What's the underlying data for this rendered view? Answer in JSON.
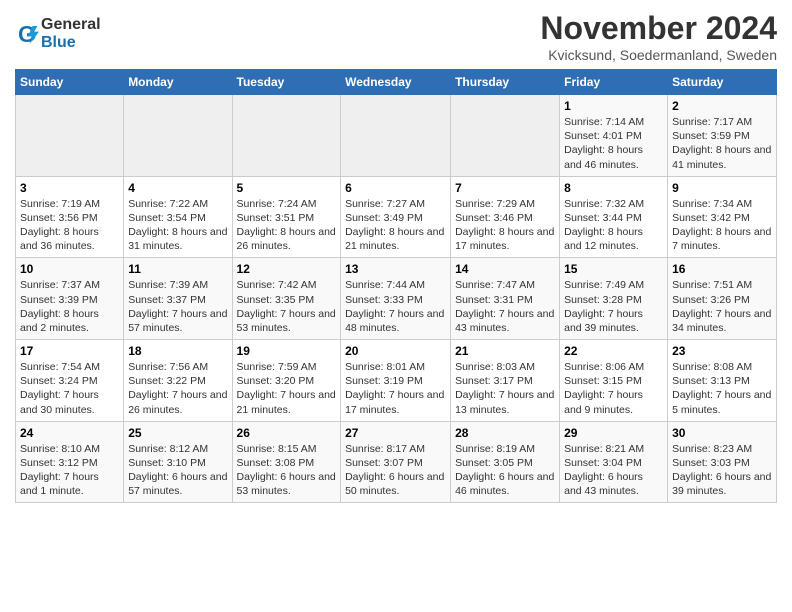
{
  "header": {
    "logo_general": "General",
    "logo_blue": "Blue",
    "title": "November 2024",
    "subtitle": "Kvicksund, Soedermanland, Sweden"
  },
  "weekdays": [
    "Sunday",
    "Monday",
    "Tuesday",
    "Wednesday",
    "Thursday",
    "Friday",
    "Saturday"
  ],
  "weeks": [
    [
      {
        "day": "",
        "info": ""
      },
      {
        "day": "",
        "info": ""
      },
      {
        "day": "",
        "info": ""
      },
      {
        "day": "",
        "info": ""
      },
      {
        "day": "",
        "info": ""
      },
      {
        "day": "1",
        "info": "Sunrise: 7:14 AM\nSunset: 4:01 PM\nDaylight: 8 hours and 46 minutes."
      },
      {
        "day": "2",
        "info": "Sunrise: 7:17 AM\nSunset: 3:59 PM\nDaylight: 8 hours and 41 minutes."
      }
    ],
    [
      {
        "day": "3",
        "info": "Sunrise: 7:19 AM\nSunset: 3:56 PM\nDaylight: 8 hours and 36 minutes."
      },
      {
        "day": "4",
        "info": "Sunrise: 7:22 AM\nSunset: 3:54 PM\nDaylight: 8 hours and 31 minutes."
      },
      {
        "day": "5",
        "info": "Sunrise: 7:24 AM\nSunset: 3:51 PM\nDaylight: 8 hours and 26 minutes."
      },
      {
        "day": "6",
        "info": "Sunrise: 7:27 AM\nSunset: 3:49 PM\nDaylight: 8 hours and 21 minutes."
      },
      {
        "day": "7",
        "info": "Sunrise: 7:29 AM\nSunset: 3:46 PM\nDaylight: 8 hours and 17 minutes."
      },
      {
        "day": "8",
        "info": "Sunrise: 7:32 AM\nSunset: 3:44 PM\nDaylight: 8 hours and 12 minutes."
      },
      {
        "day": "9",
        "info": "Sunrise: 7:34 AM\nSunset: 3:42 PM\nDaylight: 8 hours and 7 minutes."
      }
    ],
    [
      {
        "day": "10",
        "info": "Sunrise: 7:37 AM\nSunset: 3:39 PM\nDaylight: 8 hours and 2 minutes."
      },
      {
        "day": "11",
        "info": "Sunrise: 7:39 AM\nSunset: 3:37 PM\nDaylight: 7 hours and 57 minutes."
      },
      {
        "day": "12",
        "info": "Sunrise: 7:42 AM\nSunset: 3:35 PM\nDaylight: 7 hours and 53 minutes."
      },
      {
        "day": "13",
        "info": "Sunrise: 7:44 AM\nSunset: 3:33 PM\nDaylight: 7 hours and 48 minutes."
      },
      {
        "day": "14",
        "info": "Sunrise: 7:47 AM\nSunset: 3:31 PM\nDaylight: 7 hours and 43 minutes."
      },
      {
        "day": "15",
        "info": "Sunrise: 7:49 AM\nSunset: 3:28 PM\nDaylight: 7 hours and 39 minutes."
      },
      {
        "day": "16",
        "info": "Sunrise: 7:51 AM\nSunset: 3:26 PM\nDaylight: 7 hours and 34 minutes."
      }
    ],
    [
      {
        "day": "17",
        "info": "Sunrise: 7:54 AM\nSunset: 3:24 PM\nDaylight: 7 hours and 30 minutes."
      },
      {
        "day": "18",
        "info": "Sunrise: 7:56 AM\nSunset: 3:22 PM\nDaylight: 7 hours and 26 minutes."
      },
      {
        "day": "19",
        "info": "Sunrise: 7:59 AM\nSunset: 3:20 PM\nDaylight: 7 hours and 21 minutes."
      },
      {
        "day": "20",
        "info": "Sunrise: 8:01 AM\nSunset: 3:19 PM\nDaylight: 7 hours and 17 minutes."
      },
      {
        "day": "21",
        "info": "Sunrise: 8:03 AM\nSunset: 3:17 PM\nDaylight: 7 hours and 13 minutes."
      },
      {
        "day": "22",
        "info": "Sunrise: 8:06 AM\nSunset: 3:15 PM\nDaylight: 7 hours and 9 minutes."
      },
      {
        "day": "23",
        "info": "Sunrise: 8:08 AM\nSunset: 3:13 PM\nDaylight: 7 hours and 5 minutes."
      }
    ],
    [
      {
        "day": "24",
        "info": "Sunrise: 8:10 AM\nSunset: 3:12 PM\nDaylight: 7 hours and 1 minute."
      },
      {
        "day": "25",
        "info": "Sunrise: 8:12 AM\nSunset: 3:10 PM\nDaylight: 6 hours and 57 minutes."
      },
      {
        "day": "26",
        "info": "Sunrise: 8:15 AM\nSunset: 3:08 PM\nDaylight: 6 hours and 53 minutes."
      },
      {
        "day": "27",
        "info": "Sunrise: 8:17 AM\nSunset: 3:07 PM\nDaylight: 6 hours and 50 minutes."
      },
      {
        "day": "28",
        "info": "Sunrise: 8:19 AM\nSunset: 3:05 PM\nDaylight: 6 hours and 46 minutes."
      },
      {
        "day": "29",
        "info": "Sunrise: 8:21 AM\nSunset: 3:04 PM\nDaylight: 6 hours and 43 minutes."
      },
      {
        "day": "30",
        "info": "Sunrise: 8:23 AM\nSunset: 3:03 PM\nDaylight: 6 hours and 39 minutes."
      }
    ]
  ]
}
